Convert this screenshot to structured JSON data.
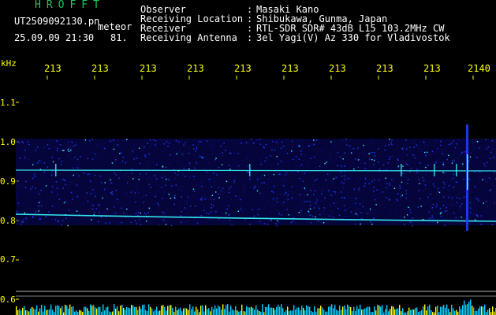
{
  "header": {
    "app_title": "HROFFT",
    "filename": "UT2509092130.pn",
    "type_label": "meteor",
    "datetime": "25.09.09 21:30",
    "count": "81."
  },
  "info": [
    {
      "label": "Observer",
      "value": "Masaki Kano"
    },
    {
      "label": "Receiving Location",
      "value": "Shibukawa, Gunma, Japan"
    },
    {
      "label": "Receiver",
      "value": "RTL-SDR SDR# 43dB L15 103.2MHz CW"
    },
    {
      "label": "Receiving Antenna",
      "value": "3el Yagi(V) Az 330 for Vladivostok"
    }
  ],
  "colon": ":",
  "axes": {
    "unit_label": "kHz",
    "y_ticks": [
      "1.1",
      "1.0",
      "0.9",
      "0.8",
      "0.7",
      "0.6"
    ],
    "x_ticks": [
      "213",
      "213",
      "213",
      "213",
      "213",
      "213",
      "213",
      "213",
      "213",
      "2140"
    ],
    "x_tick_suffixes": [
      "",
      "",
      "",
      "",
      "",
      "",
      "",
      "",
      "",
      ""
    ]
  },
  "colors": {
    "background": "#000000",
    "text": "#ffffff",
    "title": "#22c55e",
    "axis": "#ffff00",
    "signal_dark": "#0a0a6e",
    "signal_mid": "#1e3cff",
    "signal_bright": "#39ffff",
    "meter_bar": "#00cfff"
  }
}
